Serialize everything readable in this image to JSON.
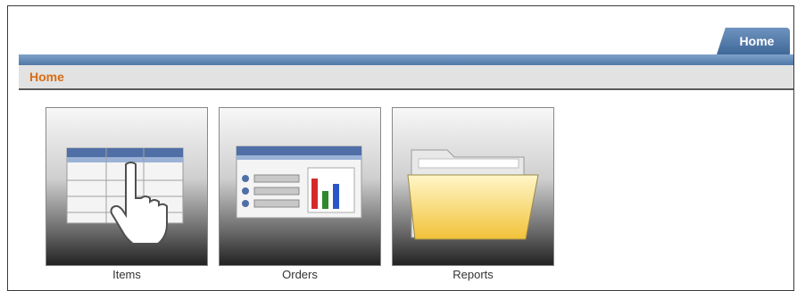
{
  "header": {
    "tab_label": "Home"
  },
  "breadcrumb": {
    "label": "Home"
  },
  "tiles": [
    {
      "label": "Items",
      "icon": "table-hand-icon"
    },
    {
      "label": "Orders",
      "icon": "list-chart-icon"
    },
    {
      "label": "Reports",
      "icon": "folder-icon"
    }
  ]
}
